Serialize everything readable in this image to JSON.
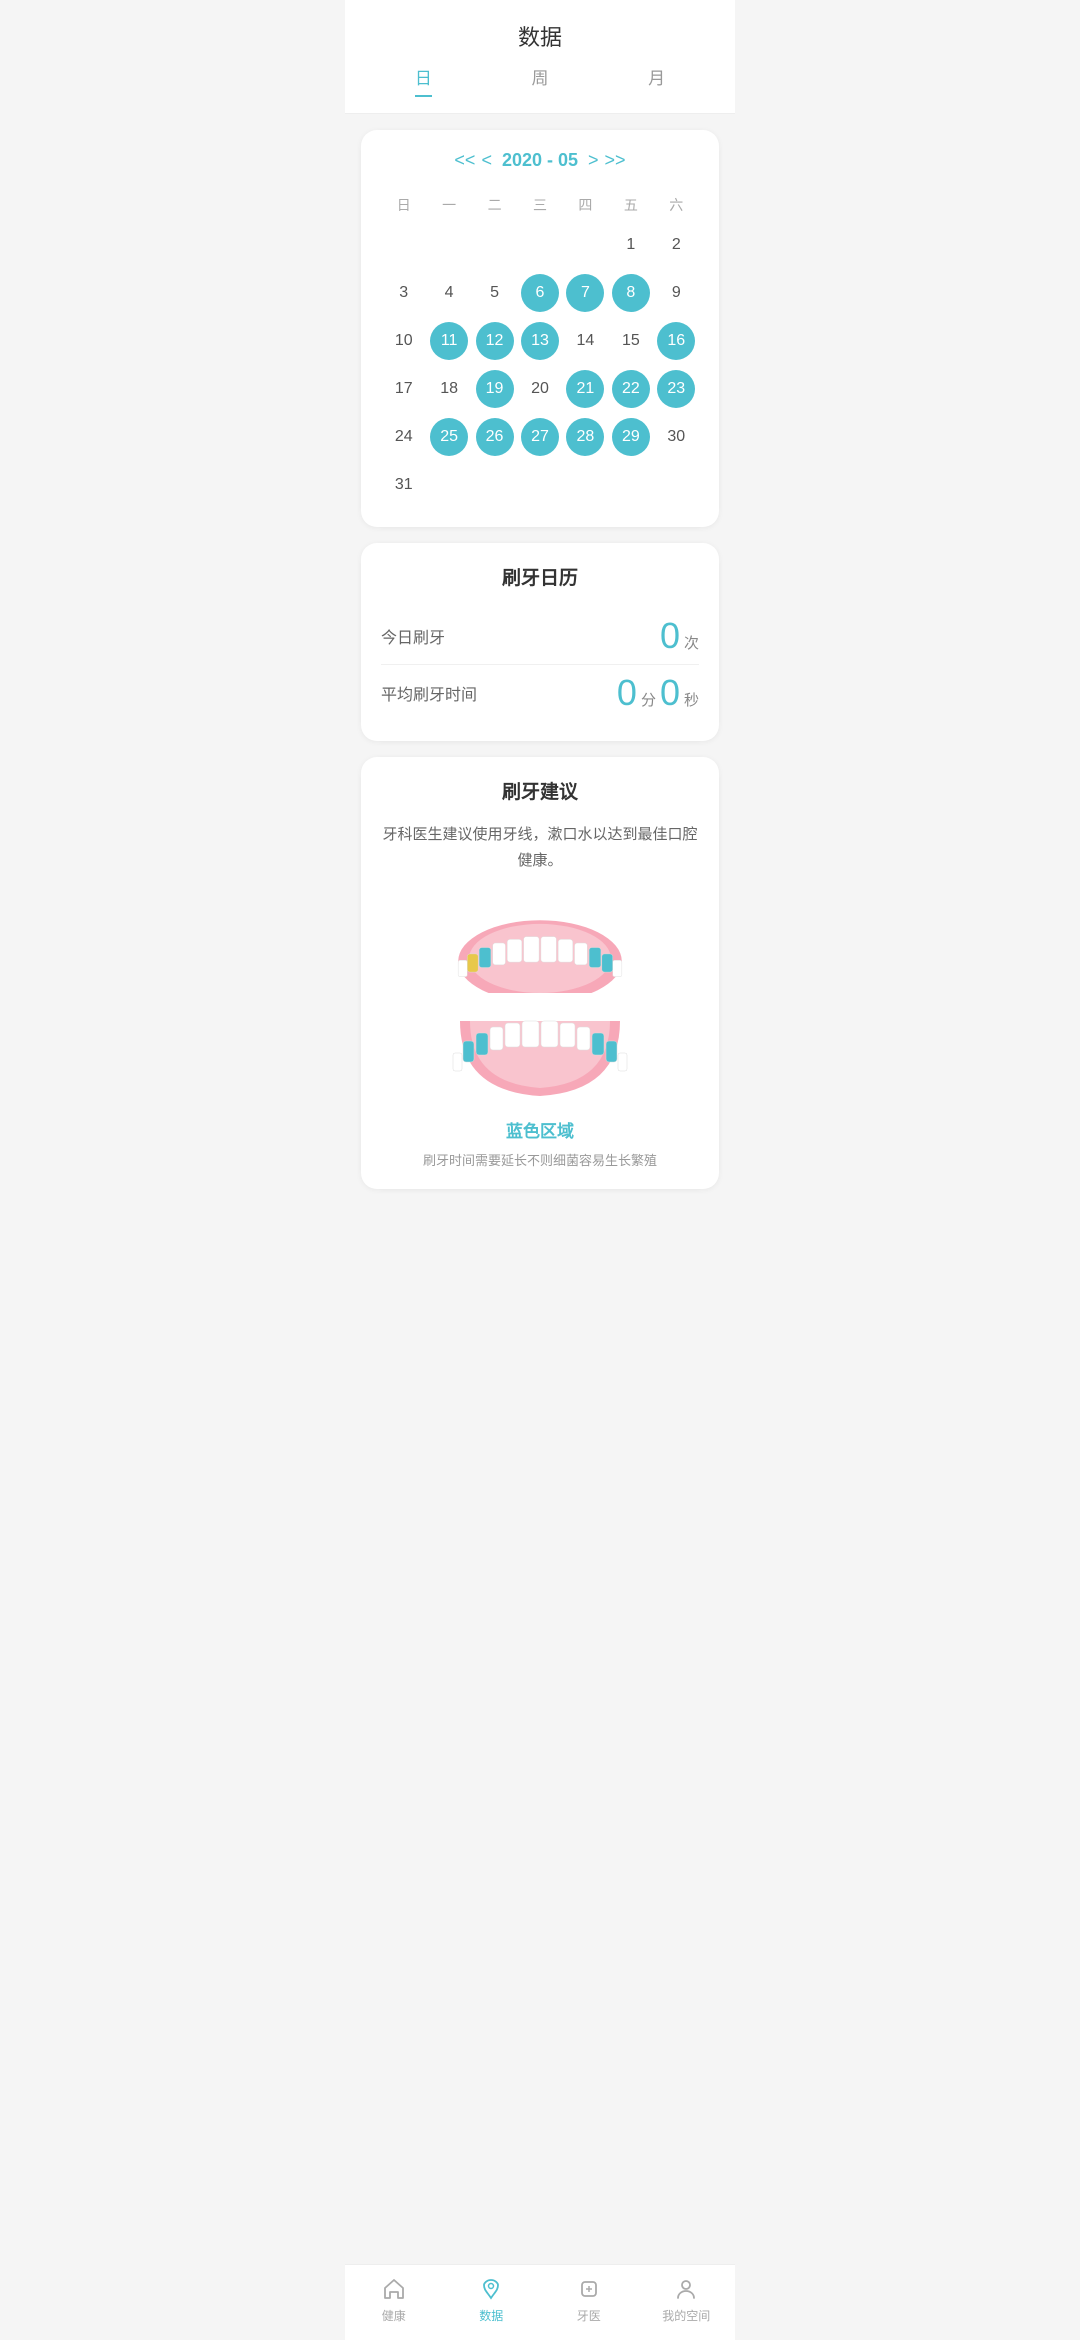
{
  "page": {
    "title": "数据"
  },
  "tabs": [
    {
      "label": "日",
      "active": true
    },
    {
      "label": "周",
      "active": false
    },
    {
      "label": "月",
      "active": false
    }
  ],
  "calendar": {
    "nav": {
      "prev_prev": "<<",
      "prev": "<",
      "year_month": "2020 - 05",
      "next": ">",
      "next_next": ">>"
    },
    "days_of_week": [
      "日",
      "一",
      "二",
      "三",
      "四",
      "五",
      "六"
    ],
    "weeks": [
      [
        {
          "date": "",
          "empty": true
        },
        {
          "date": "",
          "empty": true
        },
        {
          "date": "",
          "empty": true
        },
        {
          "date": "",
          "empty": true
        },
        {
          "date": "",
          "empty": true
        },
        {
          "date": "1",
          "highlighted": false
        },
        {
          "date": "2",
          "highlighted": false
        }
      ],
      [
        {
          "date": "3",
          "highlighted": false
        },
        {
          "date": "4",
          "highlighted": false
        },
        {
          "date": "5",
          "highlighted": false
        },
        {
          "date": "6",
          "highlighted": true
        },
        {
          "date": "7",
          "highlighted": true
        },
        {
          "date": "8",
          "highlighted": true
        },
        {
          "date": "9",
          "highlighted": false
        }
      ],
      [
        {
          "date": "10",
          "highlighted": false
        },
        {
          "date": "11",
          "highlighted": true
        },
        {
          "date": "12",
          "highlighted": true
        },
        {
          "date": "13",
          "highlighted": true
        },
        {
          "date": "14",
          "highlighted": false
        },
        {
          "date": "15",
          "highlighted": false
        },
        {
          "date": "16",
          "highlighted": true
        }
      ],
      [
        {
          "date": "17",
          "highlighted": false
        },
        {
          "date": "18",
          "highlighted": false
        },
        {
          "date": "19",
          "highlighted": true
        },
        {
          "date": "20",
          "highlighted": false
        },
        {
          "date": "21",
          "highlighted": true
        },
        {
          "date": "22",
          "highlighted": true
        },
        {
          "date": "23",
          "highlighted": true
        }
      ],
      [
        {
          "date": "24",
          "highlighted": false
        },
        {
          "date": "25",
          "highlighted": true
        },
        {
          "date": "26",
          "highlighted": true
        },
        {
          "date": "27",
          "highlighted": true
        },
        {
          "date": "28",
          "highlighted": true
        },
        {
          "date": "29",
          "highlighted": true
        },
        {
          "date": "30",
          "highlighted": false
        }
      ],
      [
        {
          "date": "31",
          "highlighted": false
        },
        {
          "date": "",
          "empty": true
        },
        {
          "date": "",
          "empty": true
        },
        {
          "date": "",
          "empty": true
        },
        {
          "date": "",
          "empty": true
        },
        {
          "date": "",
          "empty": true
        },
        {
          "date": "",
          "empty": true
        }
      ]
    ]
  },
  "brushing_calendar": {
    "title": "刷牙日历",
    "today_label": "今日刷牙",
    "today_value": "0",
    "today_unit": "次",
    "avg_label": "平均刷牙时间",
    "avg_minutes": "0",
    "min_unit": "分",
    "avg_seconds": "0",
    "sec_unit": "秒"
  },
  "brushing_advice": {
    "title": "刷牙建议",
    "text": "牙科医生建议使用牙线，漱口水以达到最佳口腔健康。",
    "blue_area_label": "蓝色区域",
    "sub_text": "刷牙时间需要延长不则细菌容易生长繁殖"
  },
  "bottom_nav": [
    {
      "label": "健康",
      "icon": "home-icon",
      "active": false
    },
    {
      "label": "数据",
      "icon": "data-icon",
      "active": true
    },
    {
      "label": "牙医",
      "icon": "tooth-icon",
      "active": false
    },
    {
      "label": "我的空间",
      "icon": "profile-icon",
      "active": false
    }
  ]
}
